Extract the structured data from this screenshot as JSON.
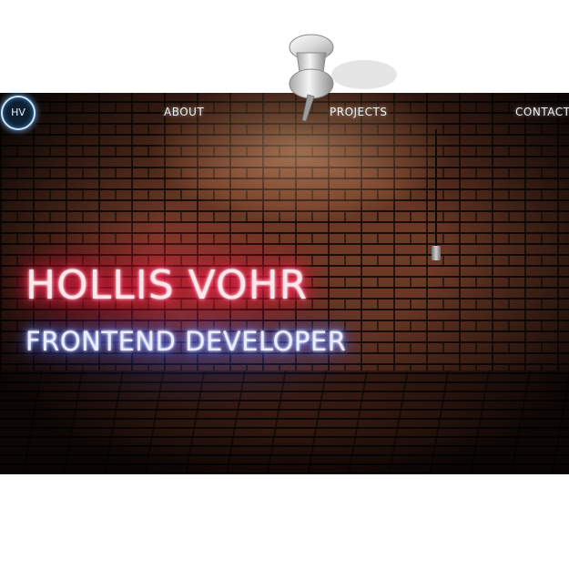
{
  "logo": {
    "initials": "HV"
  },
  "nav": {
    "about": "ABOUT",
    "projects": "PROJECTS",
    "contact": "CONTACT"
  },
  "hero": {
    "name": "HOLLIS VOHR",
    "title": "FRONTEND DEVELOPER"
  },
  "colors": {
    "neon_pink": "#ff2050",
    "neon_blue": "#4f6dff",
    "brick": "#6e3a26"
  },
  "icons": {
    "pin": "push-pin-icon"
  }
}
